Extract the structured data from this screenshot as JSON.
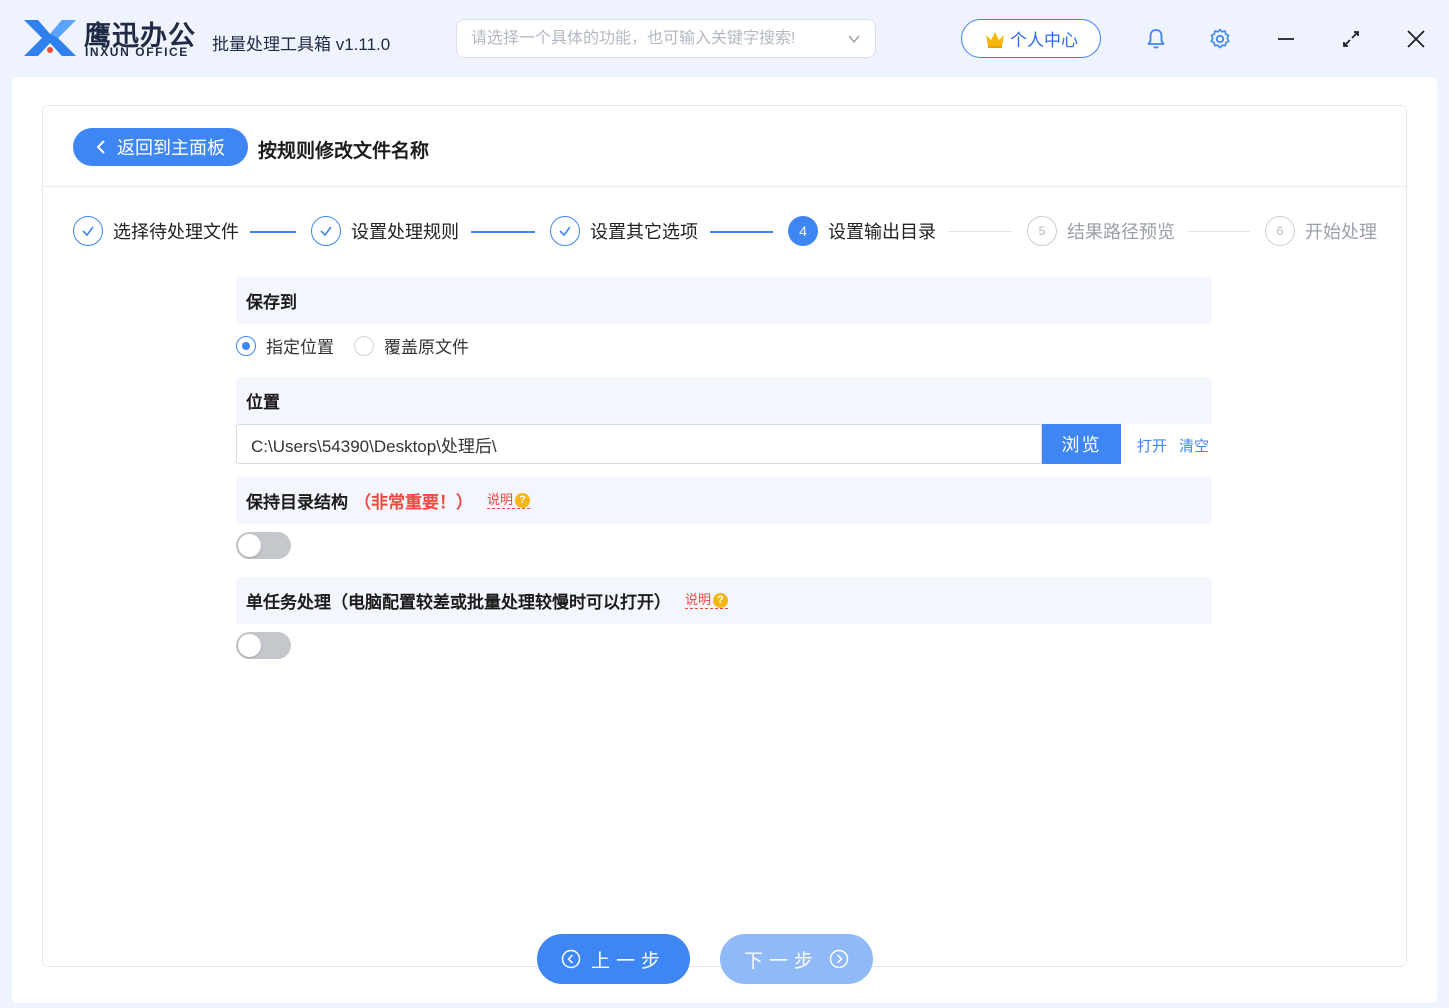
{
  "app": {
    "brand_cn": "鹰迅办公",
    "brand_en": "INXUN OFFICE",
    "title": "批量处理工具箱 v1.11.0"
  },
  "search": {
    "placeholder": "请选择一个具体的功能，也可输入关键字搜索!",
    "value": ""
  },
  "user_center": {
    "label": "个人中心"
  },
  "header": {
    "back_label": "返回到主面板",
    "page_title": "按规则修改文件名称"
  },
  "steps": [
    {
      "num": "1",
      "label": "选择待处理文件",
      "state": "done"
    },
    {
      "num": "2",
      "label": "设置处理规则",
      "state": "done"
    },
    {
      "num": "3",
      "label": "设置其它选项",
      "state": "done"
    },
    {
      "num": "4",
      "label": "设置输出目录",
      "state": "active"
    },
    {
      "num": "5",
      "label": "结果路径预览",
      "state": "todo"
    },
    {
      "num": "6",
      "label": "开始处理",
      "state": "todo"
    }
  ],
  "save_to": {
    "heading": "保存到",
    "options": [
      {
        "label": "指定位置",
        "selected": true
      },
      {
        "label": "覆盖原文件",
        "selected": false
      }
    ]
  },
  "location": {
    "heading": "位置",
    "path": "C:\\Users\\54390\\Desktop\\处理后\\",
    "browse_label": "浏览",
    "open_label": "打开",
    "clear_label": "清空"
  },
  "keep_structure": {
    "heading": "保持目录结构",
    "important": "（非常重要！）",
    "help_label": "说明",
    "enabled": false
  },
  "single_task": {
    "heading": "单任务处理（电脑配置较差或批量处理较慢时可以打开）",
    "help_label": "说明",
    "enabled": false
  },
  "footer": {
    "prev_label": "上一步",
    "next_label": "下一步"
  },
  "colors": {
    "accent": "#3f86f5",
    "accent_disabled": "#8fbaf7",
    "danger": "#f0483e",
    "help_badge": "#f5b70f"
  }
}
